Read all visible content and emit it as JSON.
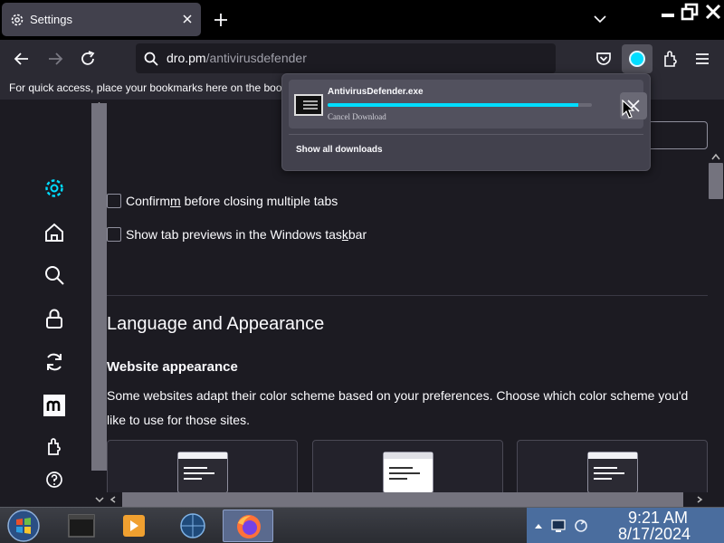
{
  "tab": {
    "title": "Settings"
  },
  "urlbar": {
    "host": "dro.pm",
    "path": "/antivirusdefender"
  },
  "bookmarks": {
    "hint": "For quick access, place your bookmarks here on the boo"
  },
  "settings": {
    "checkboxes": [
      {
        "label_pre": "Confirm",
        "label_ul": "m",
        "label_post": "before closing multiple tabs",
        "full": "Confirm before closing multiple tabs",
        "checked": false
      },
      {
        "label_pre": "Show tab previews in the Windows tas",
        "label_ul": "k",
        "label_post": "bar",
        "full": "Show tab previews in the Windows taskbar",
        "checked": false
      }
    ],
    "section_title": "Language and Appearance",
    "website_appearance": {
      "title": "Website appearance",
      "description": "Some websites adapt their color scheme based on your preferences. Choose which color scheme you'd like to use for those sites."
    }
  },
  "downloads_panel": {
    "file_name": "AntivirusDefender.exe",
    "status": "Cancel Download",
    "progress_percent": 95,
    "show_all": "Show all downloads"
  },
  "taskbar": {
    "time": "9:21 AM",
    "date": "8/17/2024"
  },
  "colors": {
    "accent": "#00ddff",
    "background": "#1c1b22",
    "toolbar": "#2b2a33"
  }
}
